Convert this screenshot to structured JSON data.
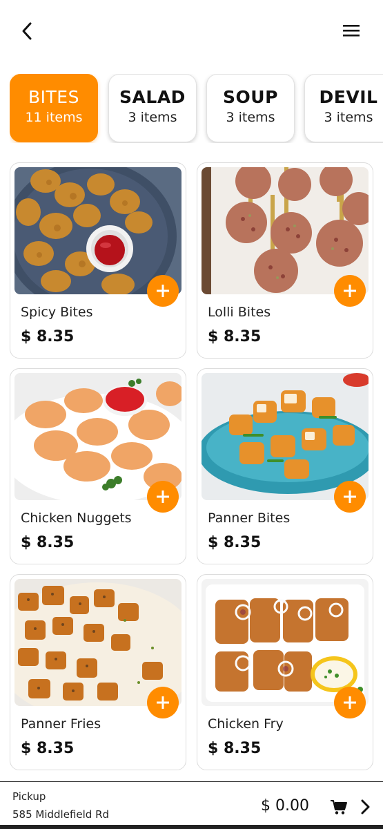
{
  "header": {
    "back_icon": "chevron-left-icon",
    "menu_icon": "hamburger-menu-icon"
  },
  "categories": [
    {
      "name": "BITES",
      "count": "11 items",
      "active": true
    },
    {
      "name": "SALAD",
      "count": "3 items",
      "active": false
    },
    {
      "name": "SOUP",
      "count": "3 items",
      "active": false
    },
    {
      "name": "DEVIL",
      "count": "3 items",
      "active": false
    }
  ],
  "products": [
    {
      "name": "Spicy Bites",
      "price": "$ 8.35"
    },
    {
      "name": "Lolli Bites",
      "price": "$ 8.35"
    },
    {
      "name": "Chicken Nuggets",
      "price": "$ 8.35"
    },
    {
      "name": "Panner Bites",
      "price": "$ 8.35"
    },
    {
      "name": "Panner Fries",
      "price": "$ 8.35"
    },
    {
      "name": "Chicken Fry",
      "price": "$ 8.35"
    }
  ],
  "footer": {
    "mode": "Pickup",
    "address": "585 Middlefield Rd",
    "total": "$ 0.00",
    "cart_icon": "cart-icon",
    "next_icon": "chevron-right-icon"
  },
  "colors": {
    "accent": "#ff8c00"
  }
}
